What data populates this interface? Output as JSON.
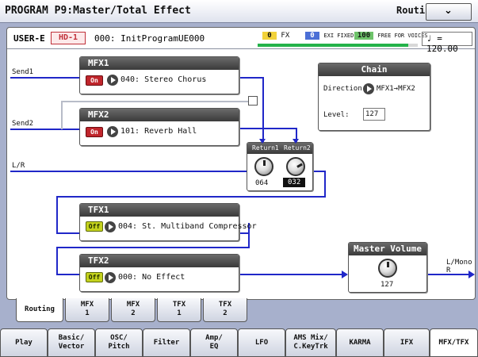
{
  "header": {
    "title": "PROGRAM P9:Master/Total Effect",
    "page": "Routing"
  },
  "info": {
    "bank": "USER-E",
    "hd": "HD-1",
    "program": "000: InitProgramUE000",
    "fx_count": "0",
    "fx_label": "FX",
    "fixed_count": "0",
    "fixed_label": "EXI FIXED",
    "free_count": "100",
    "free_label": "FREE FOR VOICES",
    "tempo": "♩ = 120.00"
  },
  "labels": {
    "send1": "Send1",
    "send2": "Send2",
    "lr": "L/R",
    "lmono": "L/Mono",
    "r": "R"
  },
  "mfx1": {
    "title": "MFX1",
    "switch": "On",
    "effect": "040: Stereo Chorus"
  },
  "mfx2": {
    "title": "MFX2",
    "switch": "On",
    "effect": "101: Reverb Hall"
  },
  "tfx1": {
    "title": "TFX1",
    "switch": "Off",
    "effect": "004: St. Multiband Compressor"
  },
  "tfx2": {
    "title": "TFX2",
    "switch": "Off",
    "effect": "000: No Effect"
  },
  "chain": {
    "title": "Chain",
    "direction_label": "Direction:",
    "direction": "MFX1→MFX2",
    "level_label": "Level:",
    "level": "127"
  },
  "returns": {
    "return1_label": "Return1",
    "return2_label": "Return2",
    "return1": "064",
    "return2": "032"
  },
  "master": {
    "title": "Master Volume",
    "value": "127"
  },
  "tabs_top": [
    "Routing",
    "MFX\n1",
    "MFX\n2",
    "TFX\n1",
    "TFX\n2"
  ],
  "tabs_bottom": [
    "Play",
    "Basic/\nVector",
    "OSC/\nPitch",
    "Filter",
    "Amp/\nEQ",
    "LFO",
    "AMS Mix/\nC.KeyTrk",
    "KARMA",
    "IFX",
    "MFX/TFX"
  ],
  "colors": {
    "routing_line": "#2027c8",
    "switch_on": "#c0262c",
    "switch_off": "#c4d21d"
  }
}
